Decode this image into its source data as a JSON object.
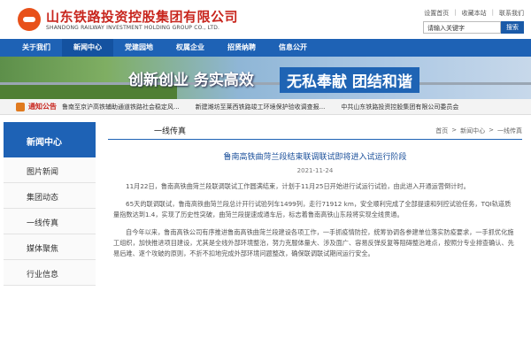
{
  "header": {
    "logo_cn": "山东铁路投资控股集团有限公司",
    "logo_en": "SHANDONG RAILWAY INVESTMENT HOLDING GROUP CO., LTD.",
    "links": [
      "设置首页",
      "收藏本站",
      "联系我们"
    ],
    "search_placeholder": "请输入关键字",
    "search_button": "搜索"
  },
  "nav": {
    "items": [
      "关于我们",
      "新闻中心",
      "党建园地",
      "权属企业",
      "招贤纳聘",
      "信息公开"
    ]
  },
  "banner": {
    "slogan_left": "创新创业 务实高效",
    "slogan_right": "无私奉献 团结和谐"
  },
  "notice": {
    "label": "通知公告",
    "items": [
      "鲁南至京沪高铁辅助通道铁路社会稳定风...",
      "新建潍坊至莱西铁路竣工环境保护验收调查报...",
      "中共山东铁路投资控股集团有限公司委员会"
    ]
  },
  "sidebar": {
    "title": "新闻中心",
    "items": [
      "图片新闻",
      "集团动态",
      "一线传真",
      "媒体聚焦",
      "行业信息"
    ]
  },
  "content": {
    "section": "一线传真",
    "breadcrumb": [
      "首页",
      ">",
      "新闻中心",
      ">",
      "一线传真"
    ],
    "title": "鲁南高铁曲菏兰段结束联调联试即将进入试运行阶段",
    "date": "2021-11-24",
    "paragraphs": [
      "11月22日，鲁南高铁曲菏兰段联调联试工作圆满结束，计划于11月25日开始进行试运行试验，由此进入开通运营倒计时。",
      "65天的联调联试，鲁南高铁曲菏兰段总计开行试验列车1499列，走行71912 km，安全顺利完成了全部提速和列控试验任务，TQI轨道质量指数达到1.4，实现了历史性突破，曲菏兰段提速成通车后，标志着鲁南高铁山东段将实现全线贯通。",
      "自今年以来，鲁南高铁公司有序推进鲁南高铁曲菏兰段建设各项工作，一手抓疫情防控，统筹协调各参建单位落实防疫要求，一手抓优化施工组织，加快推进项目建设，尤其是全线外部环境整治，努力克服体量大、涉及面广、容易反弹反复等阻碍整治难点，按照分专业排查确认、先易后难、逐个攻破的原则，不折不扣地完成外部环境问题整改，确保联调联试期间运行安全。"
    ]
  }
}
